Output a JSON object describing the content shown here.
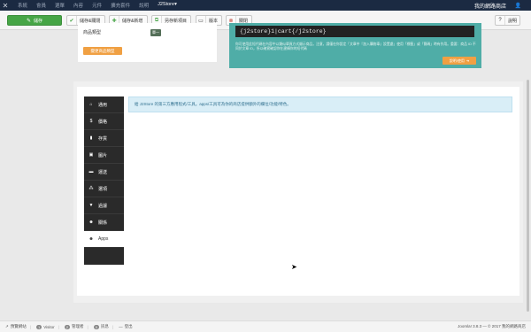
{
  "topnav": {
    "menu": [
      "系統",
      "會員",
      "選單",
      "內容",
      "元件",
      "擴充套件",
      "說明",
      "J2Store▾"
    ],
    "site": "我的網路商店",
    "user_icon": "user-icon"
  },
  "toolbar": {
    "save": "儲存",
    "save_close": "儲存&關閉",
    "save_new": "儲存&新增",
    "save_copy": "另存新項目",
    "versions": "版本",
    "close": "關閉",
    "help": "說明"
  },
  "product": {
    "type_label": "商品類型",
    "type_badge": "單一",
    "change_btn": "變更商品類型"
  },
  "shortcode": {
    "code": "{j2store}1|cart{/j2store}",
    "help_text": "你可使用此短代碼在內容中以類似單頁方式顯示商品。注意，請僅在你設定「文章中『加入購物車』設置處」使用「標籤」或「簡碼」時有作用。重要：商品 ID 不同於文章 ID，所以確實確認你在建構你的短代碼",
    "howto": "說明/使用"
  },
  "tabs": [
    {
      "label": "通用",
      "icon": "home-icon"
    },
    {
      "label": "價格",
      "icon": "dollar-icon"
    },
    {
      "label": "存貨",
      "icon": "stock-icon"
    },
    {
      "label": "圖片",
      "icon": "image-icon"
    },
    {
      "label": "運送",
      "icon": "truck-icon"
    },
    {
      "label": "選項",
      "icon": "options-icon"
    },
    {
      "label": "過濾",
      "icon": "filter-icon"
    },
    {
      "label": "關係",
      "icon": "relations-icon"
    },
    {
      "label": "Apps",
      "icon": "apps-icon",
      "selected": true
    }
  ],
  "info_message": "給 J2Store 的第三方應用程式/工具。apps/工具可為你的商店提供額外的欄位/功能/特色。",
  "statusbar": {
    "preview": "預覽網站",
    "visitor_count": "1",
    "visitor": "Visitor",
    "admin_count": "2",
    "admin": "管理者",
    "messages_count": "0",
    "messages": "訊息",
    "logout": "登出",
    "copyright": "Joomla! 3.8.3 — © 2017 我的網路商店"
  },
  "colors": {
    "nav_bg": "#1b2a42",
    "save_green": "#46a546",
    "teal": "#4fada7",
    "orange": "#f0a043",
    "info_bg": "#d9eef7"
  }
}
